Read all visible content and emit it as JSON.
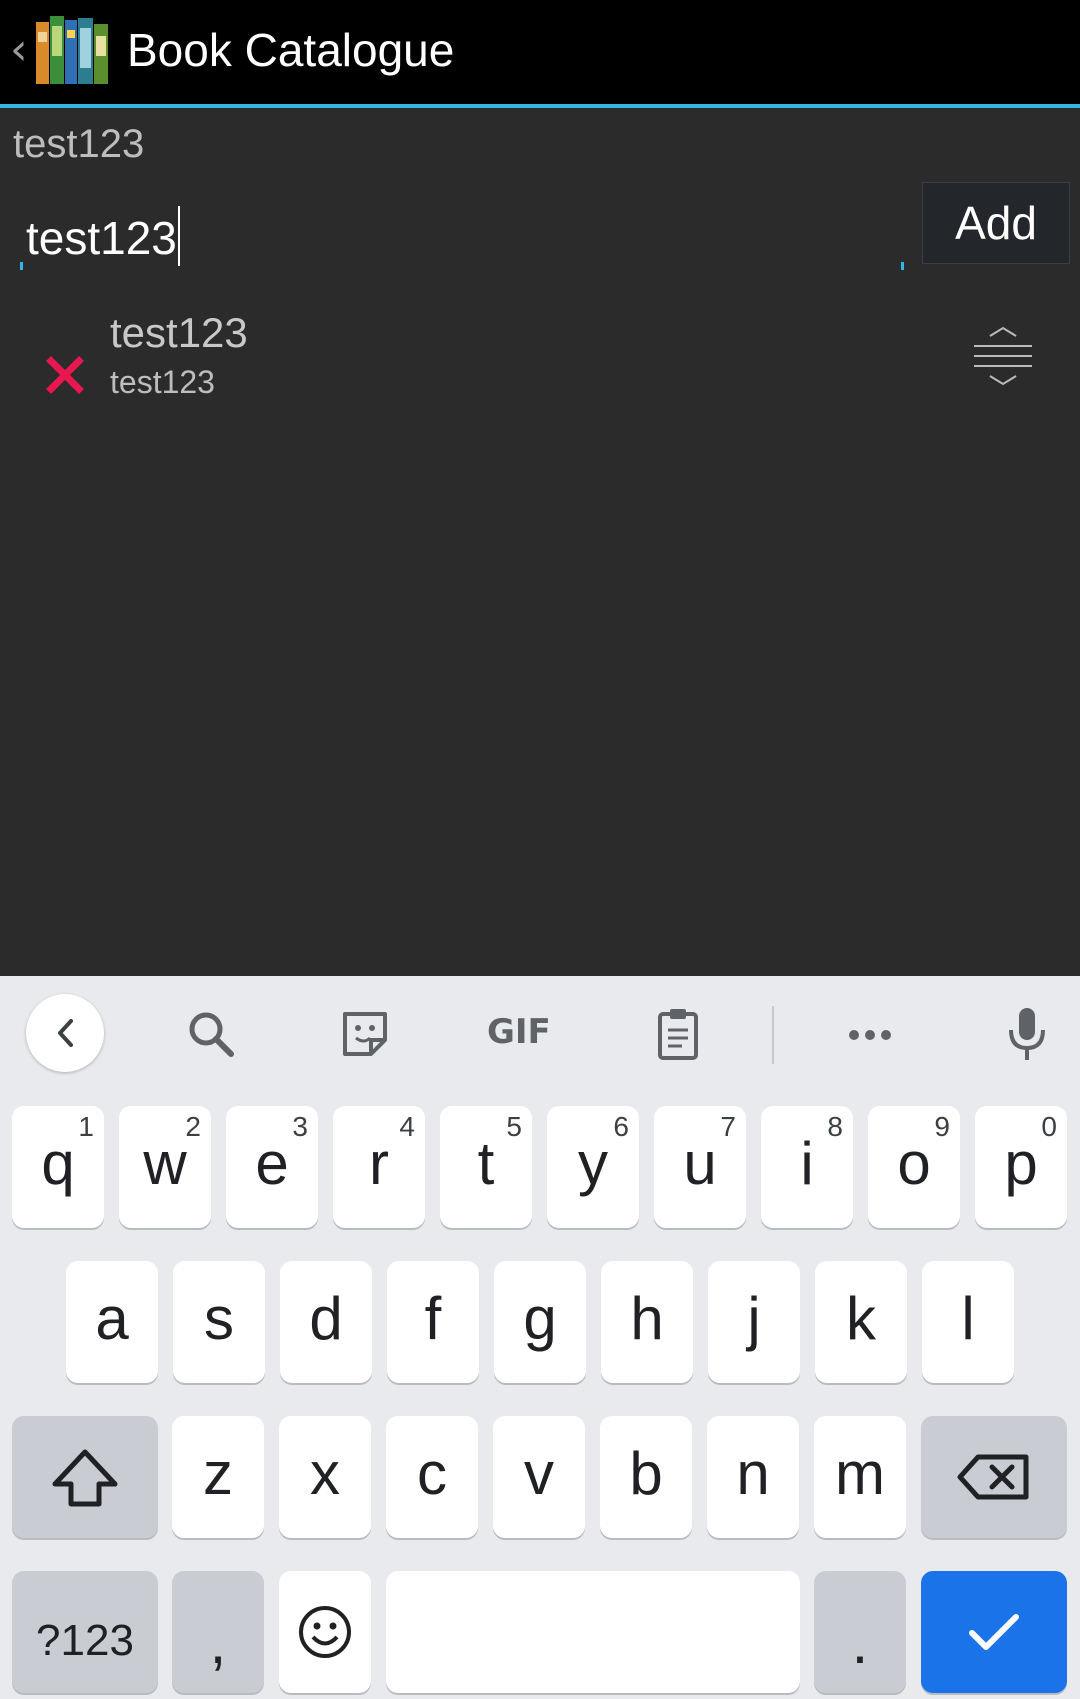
{
  "app_bar": {
    "title": "Book Catalogue",
    "back_icon": "chevron-left-icon",
    "app_icon": "books-icon"
  },
  "content": {
    "heading": "test123",
    "input_value": "test123",
    "add_label": "Add",
    "list": [
      {
        "title": "test123",
        "subtitle": "test123"
      }
    ],
    "accent": "#33b5e5",
    "delete_color": "#e8174f"
  },
  "keyboard": {
    "toolbar": [
      "back-icon",
      "search-icon",
      "sticker-icon",
      "gif-icon",
      "clipboard-icon",
      "more-icon",
      "mic-icon"
    ],
    "gif_label": "GIF",
    "row1": [
      {
        "k": "q",
        "h": "1"
      },
      {
        "k": "w",
        "h": "2"
      },
      {
        "k": "e",
        "h": "3"
      },
      {
        "k": "r",
        "h": "4"
      },
      {
        "k": "t",
        "h": "5"
      },
      {
        "k": "y",
        "h": "6"
      },
      {
        "k": "u",
        "h": "7"
      },
      {
        "k": "i",
        "h": "8"
      },
      {
        "k": "o",
        "h": "9"
      },
      {
        "k": "p",
        "h": "0"
      }
    ],
    "row2": [
      "a",
      "s",
      "d",
      "f",
      "g",
      "h",
      "j",
      "k",
      "l"
    ],
    "row3": [
      "z",
      "x",
      "c",
      "v",
      "b",
      "n",
      "m"
    ],
    "sym_label": "?123",
    "comma": ",",
    "period": ".",
    "enter_color": "#1a73e8"
  }
}
